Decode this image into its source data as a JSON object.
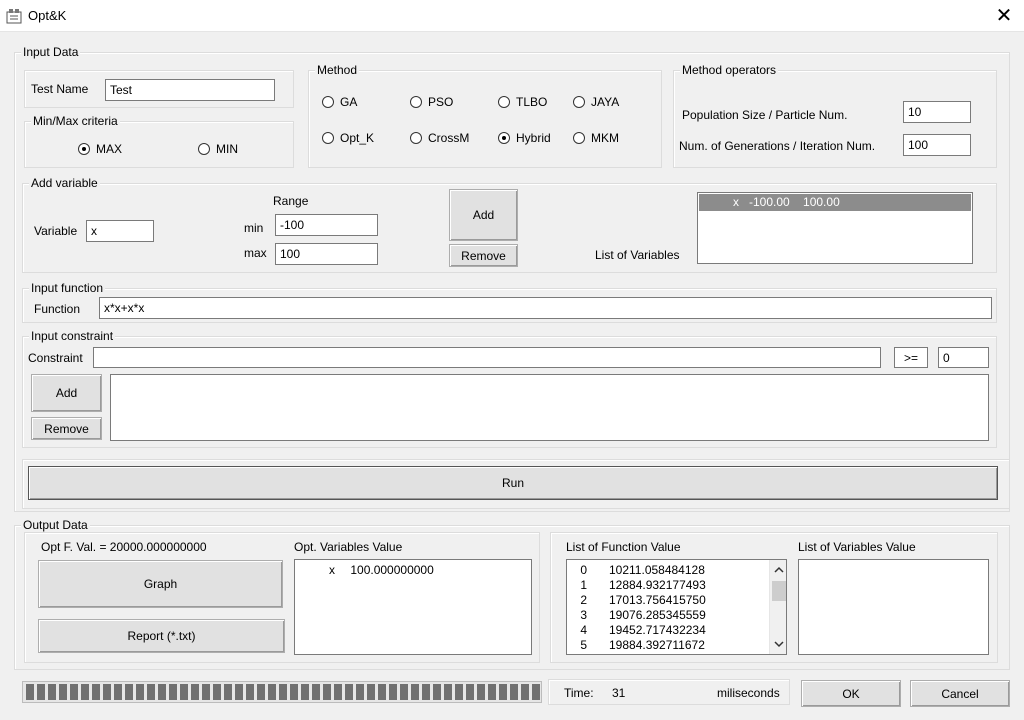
{
  "window": {
    "title": "Opt&K",
    "close_glyph": "✕"
  },
  "input_data": {
    "legend": "Input Data",
    "test_name": {
      "label": "Test Name",
      "value": "Test"
    },
    "minmax": {
      "legend": "Min/Max criteria",
      "max_label": "MAX",
      "min_label": "MIN",
      "selected": "MAX"
    },
    "method": {
      "legend": "Method",
      "options": [
        "GA",
        "PSO",
        "TLBO",
        "JAYA",
        "Opt_K",
        "CrossM",
        "Hybrid",
        "MKM"
      ],
      "selected": "Hybrid"
    },
    "operators": {
      "legend": "Method operators",
      "population_label": "Population Size / Particle Num.",
      "population_value": "10",
      "generations_label": "Num. of Generations / Iteration Num.",
      "generations_value": "100"
    },
    "add_variable": {
      "legend": "Add variable",
      "variable_label": "Variable",
      "variable_value": "x",
      "range_label": "Range",
      "min_label": "min",
      "min_value": "-100",
      "max_label": "max",
      "max_value": "100",
      "add_label": "Add",
      "remove_label": "Remove",
      "list_label": "List of Variables",
      "variables": [
        {
          "text": "x   -100.00    100.00"
        }
      ]
    },
    "function": {
      "legend": "Input function",
      "label": "Function",
      "value": "x*x+x*x"
    },
    "constraint": {
      "legend": "Input constraint",
      "label": "Constraint",
      "value": "",
      "operator": ">=",
      "rhs": "0",
      "add_label": "Add",
      "remove_label": "Remove"
    },
    "run_label": "Run"
  },
  "output_data": {
    "legend": "Output Data",
    "opt_value_text": "Opt F. Val. = 20000.000000000",
    "opt_vars_label": "Opt. Variables Value",
    "opt_vars": [
      {
        "name": "x",
        "value": "100.000000000"
      }
    ],
    "graph_label": "Graph",
    "report_label": "Report (*.txt)",
    "func_list_label": "List of Function Value",
    "func_values": [
      {
        "i": "0",
        "v": "10211.058484128"
      },
      {
        "i": "1",
        "v": "12884.932177493"
      },
      {
        "i": "2",
        "v": "17013.756415750"
      },
      {
        "i": "3",
        "v": "19076.285345559"
      },
      {
        "i": "4",
        "v": "19452.717432234"
      },
      {
        "i": "5",
        "v": "19884.392711672"
      }
    ],
    "vars_list_label": "List of Variables Value",
    "vars_list": []
  },
  "status": {
    "progress": 1.0,
    "time_label": "Time:",
    "time_value": "31",
    "time_unit": "miliseconds",
    "ok_label": "OK",
    "cancel_label": "Cancel"
  },
  "colors": {
    "background": "#f0f0f0",
    "selection": "#8c8c8c",
    "progress": "#707070"
  }
}
